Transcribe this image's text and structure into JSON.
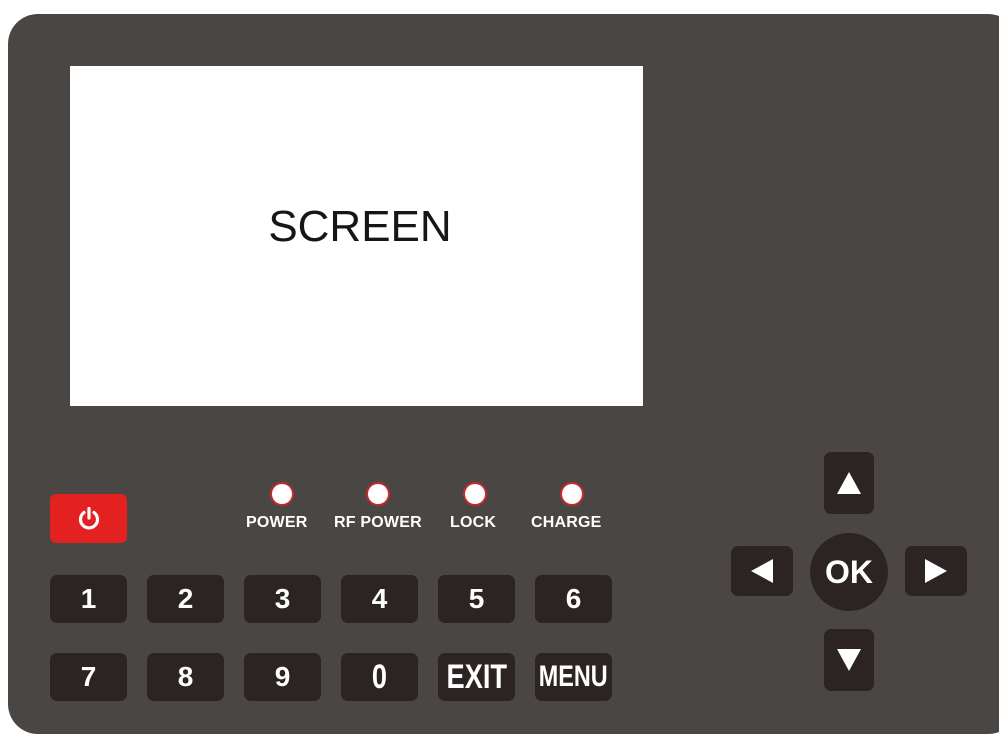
{
  "screen": {
    "label": "SCREEN"
  },
  "indicators": [
    {
      "label": "POWER"
    },
    {
      "label": "RF POWER"
    },
    {
      "label": "LOCK"
    },
    {
      "label": "CHARGE"
    }
  ],
  "keypad": {
    "row1": [
      "1",
      "2",
      "3",
      "4",
      "5",
      "6"
    ],
    "row2": [
      "7",
      "8",
      "9",
      "0",
      "EXIT",
      "MENU"
    ]
  },
  "nav": {
    "ok_label": "OK"
  },
  "icons": {
    "power": "power-icon",
    "up": "arrow-up-icon",
    "down": "arrow-down-icon",
    "left": "arrow-left-icon",
    "right": "arrow-right-icon"
  },
  "colors": {
    "panel": "#4a4644",
    "key": "#2b2422",
    "power_button": "#e32121",
    "led_ring": "#c8282b",
    "screen": "#ffffff"
  }
}
